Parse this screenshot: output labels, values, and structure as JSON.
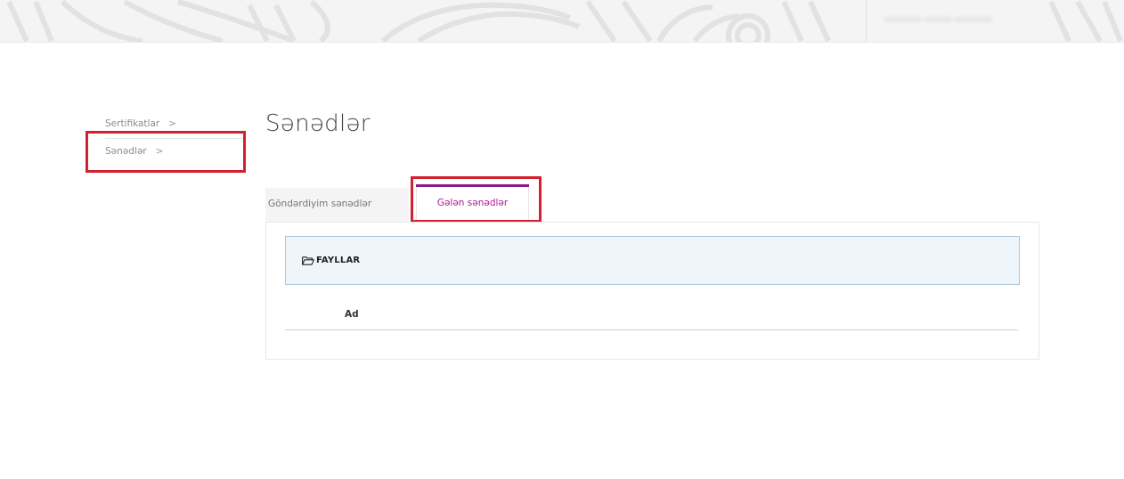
{
  "header": {
    "user_name": "•••••••• •••••• ••••••••"
  },
  "sidebar": {
    "items": [
      {
        "label": "Sertifikatlar",
        "chevron": ">"
      },
      {
        "label": "Sənədlər",
        "chevron": ">"
      }
    ]
  },
  "page": {
    "title": "Sənədlər"
  },
  "tabs": [
    {
      "label": "Göndərdiyim sənədlər",
      "active": false
    },
    {
      "label": "Gələn sənədlər",
      "active": true
    }
  ],
  "files": {
    "header_label": "FAYLLAR",
    "columns": [
      "Ad"
    ]
  },
  "colors": {
    "accent": "#8c1a86",
    "active_tab_text": "#b0188f",
    "annotation_red": "#d4202f",
    "files_header_bg": "#eef5fb",
    "files_header_border": "#a9c6db"
  },
  "icons": {
    "files_header_icon": "folder-open-icon",
    "sidebar_chevron": "chevron-right-icon"
  }
}
